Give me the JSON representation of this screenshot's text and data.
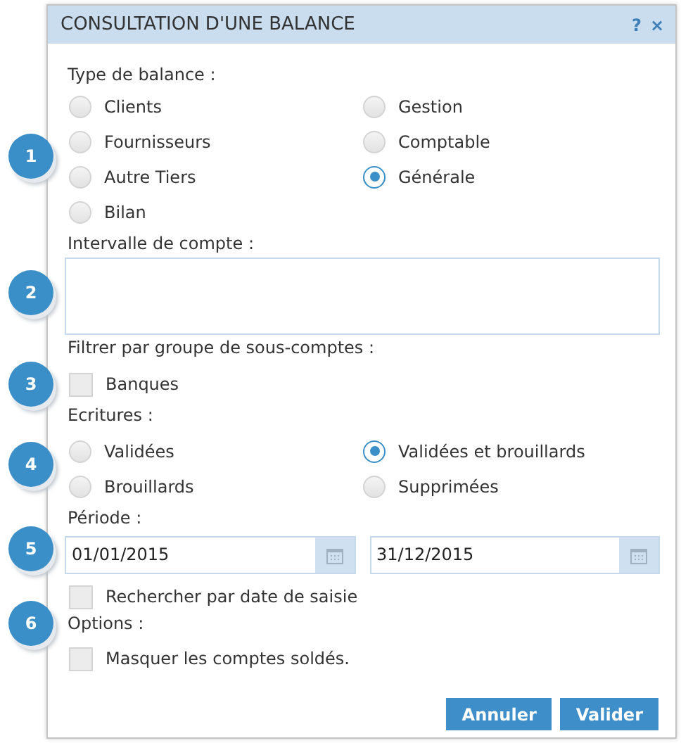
{
  "dialog": {
    "title": "CONSULTATION D'UNE BALANCE",
    "help": "?",
    "close": "×"
  },
  "balance_type": {
    "badge": "1",
    "label": "Type de balance :",
    "options": [
      {
        "label": "Clients",
        "selected": false
      },
      {
        "label": "Gestion",
        "selected": false
      },
      {
        "label": "Fournisseurs",
        "selected": false
      },
      {
        "label": "Comptable",
        "selected": false
      },
      {
        "label": "Autre Tiers",
        "selected": false
      },
      {
        "label": "Générale",
        "selected": true
      },
      {
        "label": "Bilan",
        "selected": false
      }
    ]
  },
  "account_range": {
    "badge": "2",
    "label": "Intervalle de compte :"
  },
  "subaccount_filter": {
    "badge": "3",
    "label": "Filtrer par groupe de sous-comptes :",
    "options": [
      {
        "label": "Banques",
        "checked": false
      }
    ]
  },
  "entries": {
    "badge": "4",
    "label": "Ecritures :",
    "options": [
      {
        "label": "Validées",
        "selected": false
      },
      {
        "label": "Validées et brouillards",
        "selected": true
      },
      {
        "label": "Brouillards",
        "selected": false
      },
      {
        "label": "Supprimées",
        "selected": false
      }
    ]
  },
  "period": {
    "badge": "5",
    "label": "Période :",
    "start": "01/01/2015",
    "end": "31/12/2015",
    "by_entry_date": {
      "label": "Rechercher par date de saisie",
      "checked": false
    }
  },
  "options": {
    "badge": "6",
    "label": "Options :",
    "items": [
      {
        "label": "Masquer les comptes soldés.",
        "checked": false
      }
    ]
  },
  "buttons": [
    "Annuler",
    "Valider"
  ]
}
